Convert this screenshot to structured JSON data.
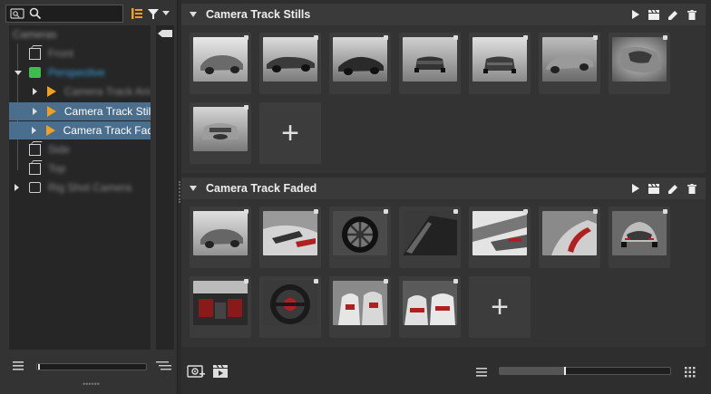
{
  "left_panel": {
    "search": {
      "placeholder": ""
    },
    "icons": [
      "camera-search-icon",
      "search-icon",
      "hierarchy-icon",
      "filter-icon",
      "chevron-down-icon"
    ],
    "tree": [
      {
        "label": "Cameras",
        "depth": 0,
        "expanded": true,
        "blurred": true
      },
      {
        "label": "Front",
        "depth": 1,
        "icon": "cube-icon",
        "blurred": true
      },
      {
        "label": "Perspective",
        "depth": 1,
        "icon": "camera-icon",
        "expanded": true,
        "blurred": true,
        "color": "#3aa6e6"
      },
      {
        "label": "Camera Track Ani",
        "depth": 2,
        "icon": "play-icon",
        "blurred": true
      },
      {
        "label": "Camera Track Stil",
        "depth": 2,
        "icon": "play-icon",
        "selected": true
      },
      {
        "label": "Camera Track Fad",
        "depth": 2,
        "icon": "play-icon",
        "selected": true
      },
      {
        "label": "Side",
        "depth": 1,
        "icon": "cube-icon",
        "blurred": true
      },
      {
        "label": "Top",
        "depth": 1,
        "icon": "cube-icon",
        "blurred": true
      },
      {
        "label": "Rig Shot Camera",
        "depth": 1,
        "icon": "rig-camera-icon",
        "blurred": true
      }
    ],
    "bottom": {
      "menu_icon": "menu-icon",
      "list_icon": "list-icon",
      "slider_value": 0
    }
  },
  "sections": [
    {
      "title": "Camera Track Stills",
      "actions": [
        "play-icon",
        "clapboard-icon",
        "edit-icon",
        "delete-icon"
      ],
      "thumbnails": 8
    },
    {
      "title": "Camera Track Faded",
      "actions": [
        "play-icon",
        "clapboard-icon",
        "edit-icon",
        "delete-icon"
      ],
      "thumbnails": 11
    }
  ],
  "add_label": "+",
  "footer": {
    "add_view_icon": "add-viewpoint-icon",
    "add_track_icon": "add-track-icon",
    "menu_icon": "menu-icon",
    "grid_icon": "grid-icon",
    "zoom_level": 0.38
  }
}
